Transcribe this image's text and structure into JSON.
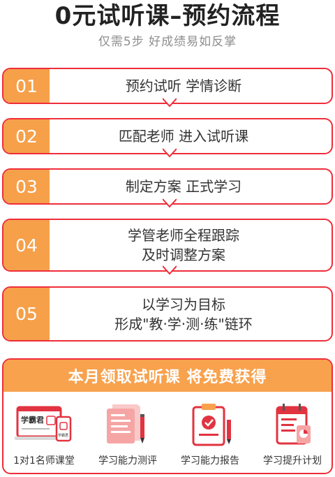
{
  "header": {
    "title": "0元试听课–预约流程",
    "subtitle": "仅需5步 好成绩易如反掌"
  },
  "steps": [
    {
      "num": "01",
      "lines": [
        "预约试听 学情诊断"
      ]
    },
    {
      "num": "02",
      "lines": [
        "匹配老师 进入试听课"
      ]
    },
    {
      "num": "03",
      "lines": [
        "制定方案 正式学习"
      ]
    },
    {
      "num": "04",
      "lines": [
        "学管老师全程跟踪",
        "及时调整方案"
      ]
    },
    {
      "num": "05",
      "lines": [
        "以学习为目标",
        "形成\"教·学·测·练\"链环"
      ]
    }
  ],
  "gift": {
    "banner": "本月领取试听课 将免费获得",
    "items": [
      {
        "label": "1对1名师课堂",
        "icon": "laptop-classroom-icon",
        "screen_text": "学霸君",
        "screen_subtext": "学霸君"
      },
      {
        "label": "学习能力测评",
        "icon": "test-paper-icon"
      },
      {
        "label": "学习能力报告",
        "icon": "clipboard-report-icon"
      },
      {
        "label": "学习提升计划",
        "icon": "calendar-plan-icon"
      }
    ]
  },
  "colors": {
    "accent_red": "#ef2d3a",
    "accent_orange": "#f6a04a"
  }
}
